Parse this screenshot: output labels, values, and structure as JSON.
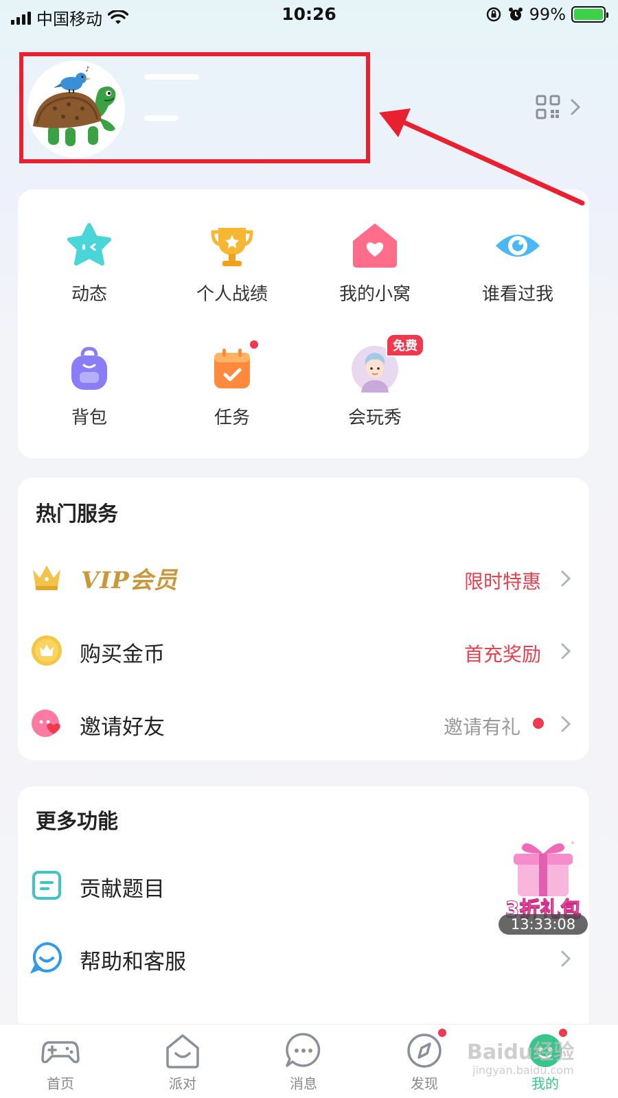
{
  "status_bar": {
    "carrier": "中国移动",
    "time": "10:26",
    "battery": "99%",
    "battery_level": 0.99
  },
  "profile": {
    "qr_icon": "qr-code-icon"
  },
  "features": [
    {
      "label": "动态",
      "icon": "star-face-icon",
      "color": "#4ad6d8"
    },
    {
      "label": "个人战绩",
      "icon": "trophy-icon",
      "color": "#f7b733"
    },
    {
      "label": "我的小窝",
      "icon": "house-heart-icon",
      "color": "#ff6d8a"
    },
    {
      "label": "谁看过我",
      "icon": "eye-icon",
      "color": "#4bb8f5"
    },
    {
      "label": "背包",
      "icon": "backpack-icon",
      "color": "#8b7cf8"
    },
    {
      "label": "任务",
      "icon": "calendar-check-icon",
      "color": "#ff8a3d"
    },
    {
      "label": "会玩秀",
      "icon": "avatar-show-icon",
      "badge": "免费"
    }
  ],
  "hot_services": {
    "title": "热门服务",
    "rows": [
      {
        "label": "VIP会员",
        "right": "限时特惠",
        "right_color": "#e8404f"
      },
      {
        "label": "购买金币",
        "right": "首充奖励",
        "right_color": "#e8404f"
      },
      {
        "label": "邀请好友",
        "right": "邀请有礼",
        "right_color": "#999999"
      }
    ]
  },
  "more_functions": {
    "title": "更多功能",
    "rows": [
      {
        "label": "贡献题目"
      },
      {
        "label": "帮助和客服"
      }
    ]
  },
  "gift": {
    "label": "3折礼包",
    "timer": "13:33:08"
  },
  "tabs": [
    {
      "label": "首页",
      "icon": "gamepad-icon"
    },
    {
      "label": "派对",
      "icon": "party-house-icon"
    },
    {
      "label": "消息",
      "icon": "message-icon"
    },
    {
      "label": "发现",
      "icon": "compass-icon"
    },
    {
      "label": "我的",
      "icon": "profile-icon",
      "active": true
    }
  ],
  "watermark": {
    "main": "Baidu经验",
    "sub": "jingyan.baidu.com"
  },
  "colors": {
    "accent_red": "#e8202f",
    "active_tab": "#38c58a",
    "gold": "#c8983a"
  }
}
